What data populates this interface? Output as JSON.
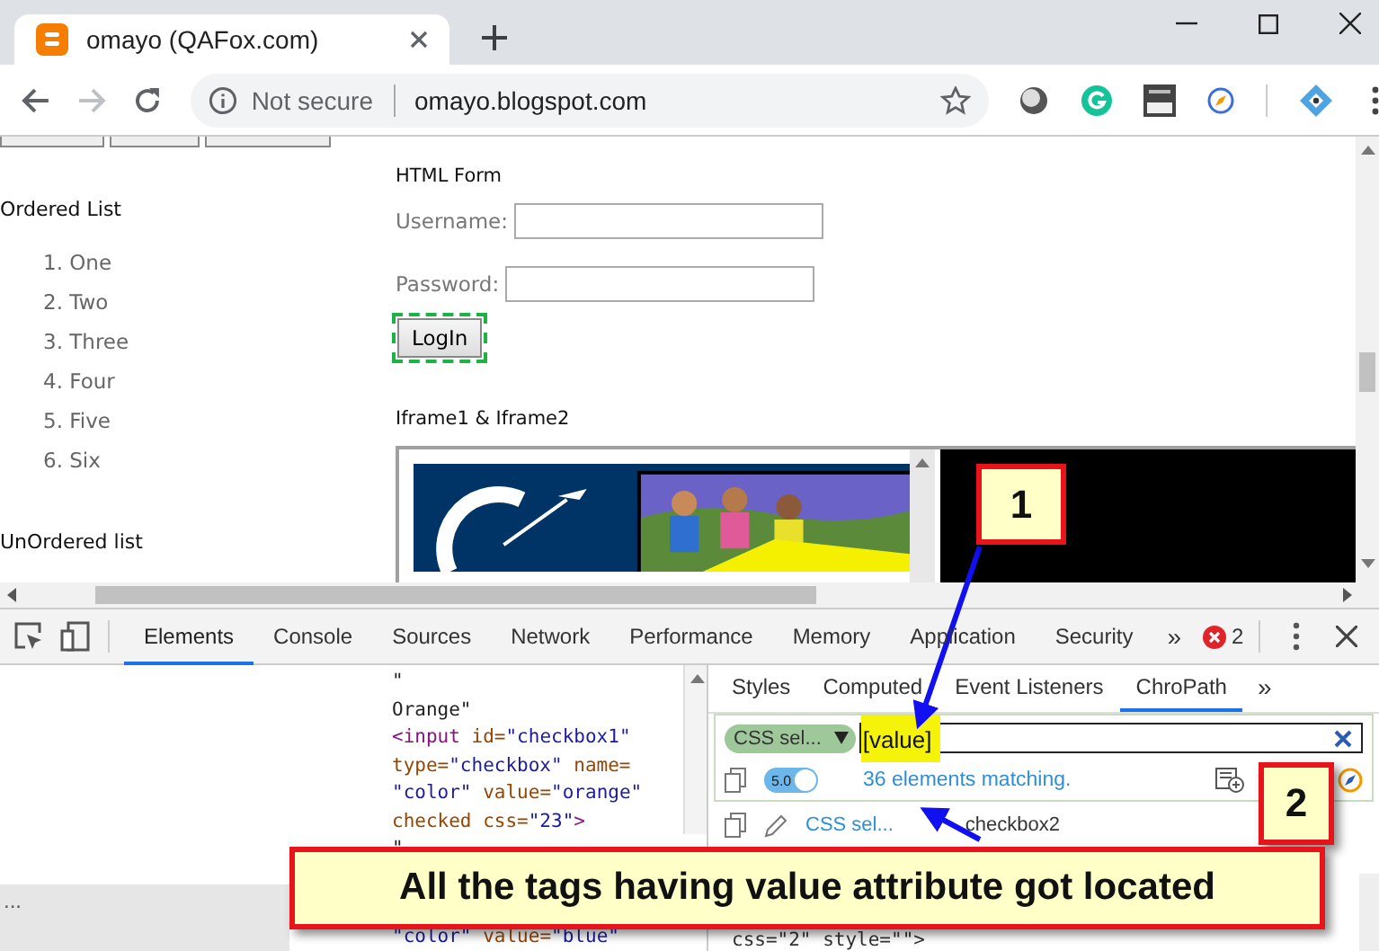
{
  "browser_tab": {
    "title": "omayo (QAFox.com)"
  },
  "nav_buttons": [
    {
      "kind": "back",
      "disabled": false
    },
    {
      "kind": "forward",
      "disabled": true
    },
    {
      "kind": "reload",
      "disabled": false
    }
  ],
  "address_bar": {
    "security": "Not secure",
    "url": "omayo.blogspot.com"
  },
  "page": {
    "ordered_list": {
      "heading": "Ordered List",
      "items": [
        "1. One",
        "2. Two",
        "3. Three",
        "4. Four",
        "5. Five",
        "6. Six"
      ]
    },
    "unordered_list": {
      "heading": "UnOrdered list"
    },
    "html_form": {
      "heading": "HTML Form",
      "fields": [
        {
          "label": "Username:"
        },
        {
          "label": "Password:"
        }
      ],
      "button": "LogIn"
    },
    "iframes": {
      "heading": "Iframe1 & Iframe2"
    }
  },
  "devtools": {
    "tabs": [
      {
        "label": "Elements",
        "selected": true
      },
      {
        "label": "Console",
        "selected": false
      },
      {
        "label": "Sources",
        "selected": false
      },
      {
        "label": "Network",
        "selected": false
      },
      {
        "label": "Performance",
        "selected": false
      },
      {
        "label": "Memory",
        "selected": false
      },
      {
        "label": "Application",
        "selected": false
      },
      {
        "label": "Security",
        "selected": false
      }
    ],
    "more": "»",
    "error_count": "2",
    "code_lines": [
      [
        {
          "kind": "text",
          "text": "\""
        }
      ],
      [
        {
          "kind": "text",
          "text": "Orange\""
        }
      ],
      [
        {
          "kind": "tag",
          "text": "<input"
        },
        {
          "kind": "attr",
          "text": " id="
        },
        {
          "kind": "value",
          "text": "\"checkbox1\""
        }
      ],
      [
        {
          "kind": "attr",
          "text": "type="
        },
        {
          "kind": "value",
          "text": "\"checkbox\""
        },
        {
          "kind": "attr",
          "text": " name="
        }
      ],
      [
        {
          "kind": "value",
          "text": "\"color\""
        },
        {
          "kind": "attr",
          "text": " value="
        },
        {
          "kind": "value",
          "text": "\"orange\""
        }
      ],
      [
        {
          "kind": "attr",
          "text": "checked css="
        },
        {
          "kind": "value",
          "text": "\"23\""
        },
        {
          "kind": "tag",
          "text": ">"
        }
      ],
      [
        {
          "kind": "text",
          "text": "\""
        }
      ]
    ],
    "last_code_line": [
      {
        "kind": "value",
        "text": "\"color\""
      },
      {
        "kind": "attr",
        "text": " value="
      },
      {
        "kind": "value",
        "text": "\"blue\""
      }
    ],
    "breadcrumb": "...",
    "side_tabs": [
      {
        "label": "Styles",
        "selected": false
      },
      {
        "label": "Computed",
        "selected": false
      },
      {
        "label": "Event Listeners",
        "selected": false
      },
      {
        "label": "ChroPath",
        "selected": true
      }
    ],
    "side_more": "»",
    "chropath": {
      "selector_type": "CSS sel...",
      "query": "[value]",
      "version": "5.0",
      "toggle_on": true,
      "match_text": "36 elements matching.",
      "result": {
        "type": "CSS sel...",
        "value": "checkbox2"
      }
    },
    "side_last_line": "css=\"2\" style=\"\">"
  },
  "callouts": [
    {
      "kind": "number",
      "text": "1"
    },
    {
      "kind": "number",
      "text": "2"
    },
    {
      "kind": "note",
      "text": "All the tags having value attribute got located"
    }
  ]
}
